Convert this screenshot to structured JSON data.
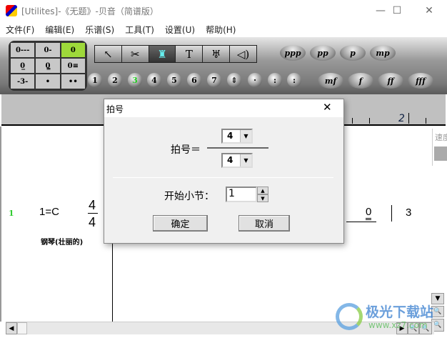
{
  "window": {
    "title": "[Utilites]-《无题》-贝音（简谱版）",
    "minimize": "—",
    "maximize": "☐",
    "close": "✕"
  },
  "menu": [
    "文件(F)",
    "编辑(E)",
    "乐谱(S)",
    "工具(T)",
    "设置(U)",
    "帮助(H)"
  ],
  "keypad": [
    "0---",
    "0-",
    "0",
    "0̲",
    "0̳",
    "0≡",
    "-3-",
    "•",
    "••"
  ],
  "tools": [
    "select-arrow",
    "scissors",
    "metronome",
    "T",
    "lyre",
    "speaker"
  ],
  "tool_glyphs": [
    "↖",
    "✂",
    "♜",
    "T",
    "♅",
    "◁)"
  ],
  "numbers": [
    "1",
    "2",
    "3",
    "4",
    "5",
    "6",
    "7",
    "⇕",
    "·",
    ":",
    ":"
  ],
  "dynamics_row1": [
    "ppp",
    "pp",
    "p",
    "mp"
  ],
  "dynamics_row2": [
    "mf",
    "f",
    "ff",
    "fff"
  ],
  "ruler": {
    "measure": "2"
  },
  "score": {
    "line_number": "1",
    "key": "1=C",
    "time_top": "4",
    "time_bottom": "4",
    "instrument": "钢琴(壮丽的)",
    "note1": "0",
    "note2": "3"
  },
  "side_panel": {
    "label": "速度"
  },
  "dialog": {
    "title": "拍号",
    "label": "拍号＝",
    "numerator": "4",
    "denominator": "4",
    "start_label": "开始小节：",
    "start_value": "1",
    "ok": "确定",
    "cancel": "取消",
    "close": "✕"
  },
  "watermark": {
    "name": "极光下载站",
    "url": "www.xz7.com"
  }
}
